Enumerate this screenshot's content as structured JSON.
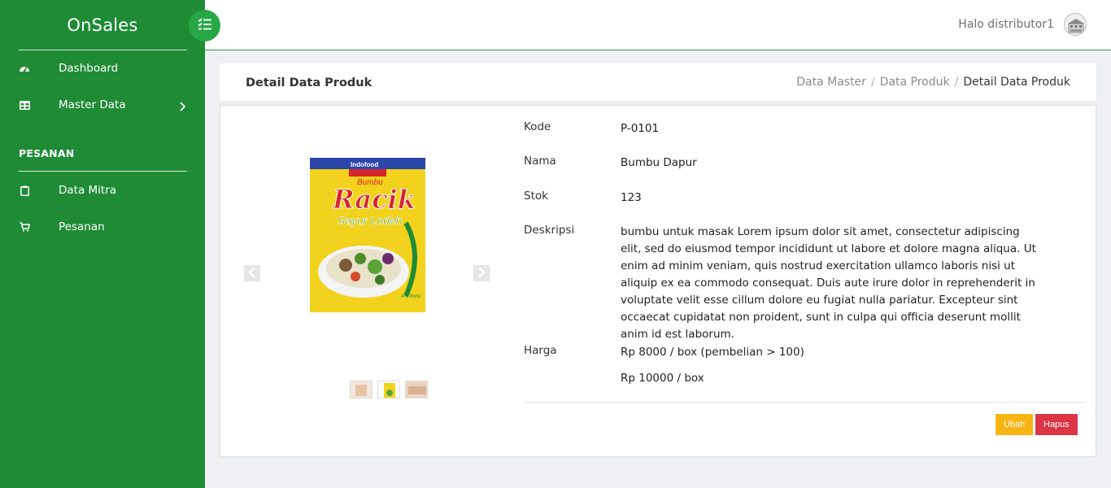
{
  "app": {
    "brand": "OnSales"
  },
  "sidebar": {
    "items": [
      {
        "label": "Dashboard",
        "icon": "gauge-icon"
      },
      {
        "label": "Master Data",
        "icon": "table-icon"
      },
      {
        "label": "Data Mitra",
        "icon": "clipboard-icon"
      },
      {
        "label": "Pesanan",
        "icon": "cart-icon"
      }
    ],
    "section_label": "PESANAN"
  },
  "topbar": {
    "greeting": "Halo distributor1"
  },
  "header": {
    "title": "Detail Data Produk",
    "breadcrumb": [
      "Data Master",
      "Data Produk",
      "Detail Data Produk"
    ],
    "separator": "/"
  },
  "product": {
    "fields": [
      {
        "key": "Kode",
        "value": "P-0101"
      },
      {
        "key": "Nama",
        "value": "Bumbu Dapur"
      },
      {
        "key": "Stok",
        "value": "123"
      },
      {
        "key": "Deskripsi",
        "value": "bumbu untuk masak Lorem ipsum dolor sit amet, consectetur adipiscing elit, sed do eiusmod tempor incididunt ut labore et dolore magna aliqua. Ut enim ad minim veniam, quis nostrud exercitation ullamco laboris nisi ut aliquip ex ea commodo consequat. Duis aute irure dolor in reprehenderit in voluptate velit esse cillum dolore eu fugiat nulla pariatur. Excepteur sint occaecat cupidatat non proident, sunt in culpa qui officia deserunt mollit anim id est laborum."
      },
      {
        "key": "Harga",
        "value": "Rp 8000 / box (pembelian > 100)"
      }
    ],
    "harga_secondary": "Rp 10000 / box",
    "image_text": {
      "brand": "Indofood",
      "line1": "Bumbu",
      "line2": "Racik",
      "line3": "Sayur Lodeh"
    }
  },
  "actions": {
    "edit": "Ubah",
    "delete": "Hapus"
  },
  "colors": {
    "sidebar": "#1f8b35",
    "toggle": "#28a745",
    "edit": "#f6b511",
    "delete": "#dc3545"
  }
}
